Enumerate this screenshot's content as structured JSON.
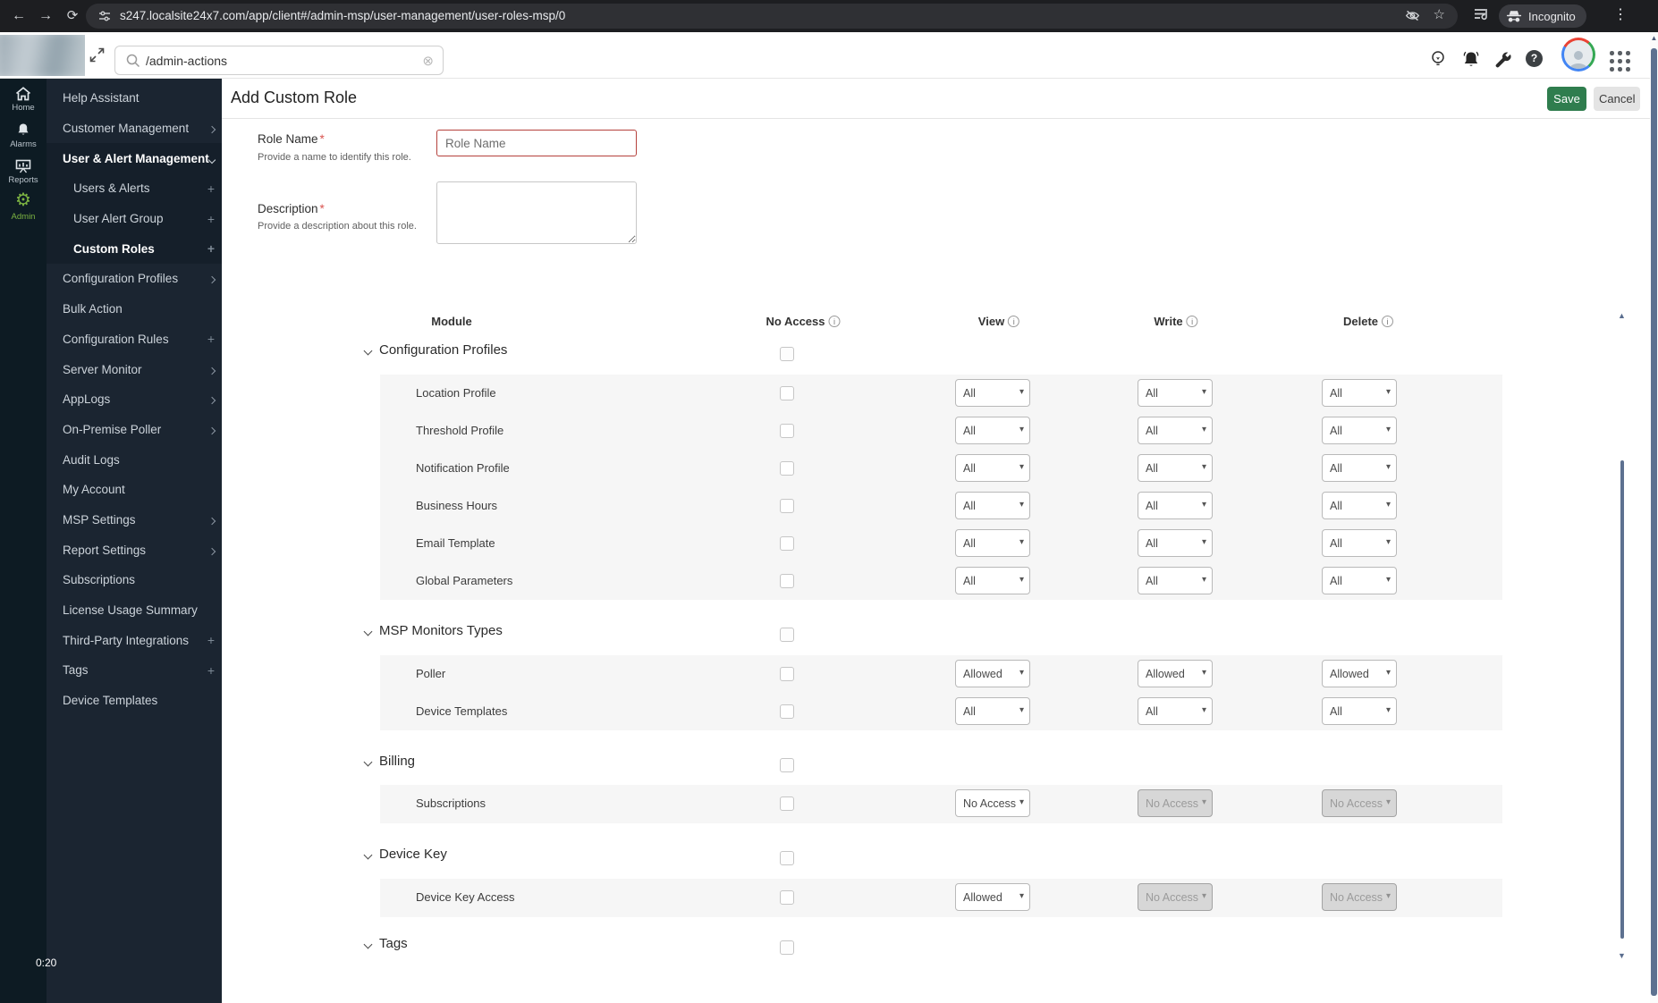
{
  "browser": {
    "url": "s247.localsite24x7.com/app/client#/admin-msp/user-management/user-roles-msp/0",
    "incognito_label": "Incognito"
  },
  "appbar": {
    "search_value": "/admin-actions"
  },
  "sidebar": {
    "rail": [
      {
        "label": "Home"
      },
      {
        "label": "Alarms"
      },
      {
        "label": "Reports"
      },
      {
        "label": "Admin"
      }
    ],
    "menu": [
      {
        "label": "Help Assistant",
        "mark": "none"
      },
      {
        "label": "Customer Management",
        "mark": "chevron-right"
      },
      {
        "label": "User & Alert Management",
        "mark": "chevron-down"
      },
      {
        "label": "Users & Alerts",
        "mark": "plus"
      },
      {
        "label": "User Alert Group",
        "mark": "plus"
      },
      {
        "label": "Custom Roles",
        "mark": "plus"
      },
      {
        "label": "Configuration Profiles",
        "mark": "chevron-right"
      },
      {
        "label": "Bulk Action",
        "mark": "none"
      },
      {
        "label": "Configuration Rules",
        "mark": "plus"
      },
      {
        "label": "Server Monitor",
        "mark": "chevron-right"
      },
      {
        "label": "AppLogs",
        "mark": "chevron-right"
      },
      {
        "label": "On-Premise Poller",
        "mark": "chevron-right"
      },
      {
        "label": "Audit Logs",
        "mark": "none"
      },
      {
        "label": "My Account",
        "mark": "none"
      },
      {
        "label": "MSP Settings",
        "mark": "chevron-right"
      },
      {
        "label": "Report Settings",
        "mark": "chevron-right"
      },
      {
        "label": "Subscriptions",
        "mark": "none"
      },
      {
        "label": "License Usage Summary",
        "mark": "none"
      },
      {
        "label": "Third-Party Integrations",
        "mark": "plus"
      },
      {
        "label": "Tags",
        "mark": "plus"
      },
      {
        "label": "Device Templates",
        "mark": "none"
      }
    ],
    "timer": "0:20"
  },
  "page": {
    "title": "Add Custom Role",
    "save_label": "Save",
    "cancel_label": "Cancel"
  },
  "form": {
    "role_name": {
      "label": "Role Name",
      "required_mark": "*",
      "help": "Provide a name to identify this role.",
      "placeholder": "Role Name"
    },
    "description": {
      "label": "Description",
      "required_mark": "*",
      "help": "Provide a description about this role."
    }
  },
  "table": {
    "headers": {
      "module": "Module",
      "no_access": "No Access",
      "view": "View",
      "write": "Write",
      "delete": "Delete"
    },
    "groups": [
      {
        "label": "Configuration Profiles",
        "rows": [
          {
            "label": "Location Profile",
            "selects": [
              {
                "value": "All",
                "disabled": false
              },
              {
                "value": "All",
                "disabled": false
              },
              {
                "value": "All",
                "disabled": false
              }
            ]
          },
          {
            "label": "Threshold Profile",
            "selects": [
              {
                "value": "All",
                "disabled": false
              },
              {
                "value": "All",
                "disabled": false
              },
              {
                "value": "All",
                "disabled": false
              }
            ]
          },
          {
            "label": "Notification Profile",
            "selects": [
              {
                "value": "All",
                "disabled": false
              },
              {
                "value": "All",
                "disabled": false
              },
              {
                "value": "All",
                "disabled": false
              }
            ]
          },
          {
            "label": "Business Hours",
            "selects": [
              {
                "value": "All",
                "disabled": false
              },
              {
                "value": "All",
                "disabled": false
              },
              {
                "value": "All",
                "disabled": false
              }
            ]
          },
          {
            "label": "Email Template",
            "selects": [
              {
                "value": "All",
                "disabled": false
              },
              {
                "value": "All",
                "disabled": false
              },
              {
                "value": "All",
                "disabled": false
              }
            ]
          },
          {
            "label": "Global Parameters",
            "selects": [
              {
                "value": "All",
                "disabled": false
              },
              {
                "value": "All",
                "disabled": false
              },
              {
                "value": "All",
                "disabled": false
              }
            ]
          }
        ]
      },
      {
        "label": "MSP Monitors Types",
        "rows": [
          {
            "label": "Poller",
            "selects": [
              {
                "value": "Allowed",
                "disabled": false
              },
              {
                "value": "Allowed",
                "disabled": false
              },
              {
                "value": "Allowed",
                "disabled": false
              }
            ]
          },
          {
            "label": "Device Templates",
            "selects": [
              {
                "value": "All",
                "disabled": false
              },
              {
                "value": "All",
                "disabled": false
              },
              {
                "value": "All",
                "disabled": false
              }
            ]
          }
        ]
      },
      {
        "label": "Billing",
        "rows": [
          {
            "label": "Subscriptions",
            "selects": [
              {
                "value": "No Access",
                "disabled": false
              },
              {
                "value": "No Access",
                "disabled": true
              },
              {
                "value": "No Access",
                "disabled": true
              }
            ]
          }
        ]
      },
      {
        "label": "Device Key",
        "rows": [
          {
            "label": "Device Key Access",
            "selects": [
              {
                "value": "Allowed",
                "disabled": false
              },
              {
                "value": "No Access",
                "disabled": true
              },
              {
                "value": "No Access",
                "disabled": true
              }
            ]
          }
        ]
      },
      {
        "label": "Tags",
        "rows": []
      }
    ]
  }
}
